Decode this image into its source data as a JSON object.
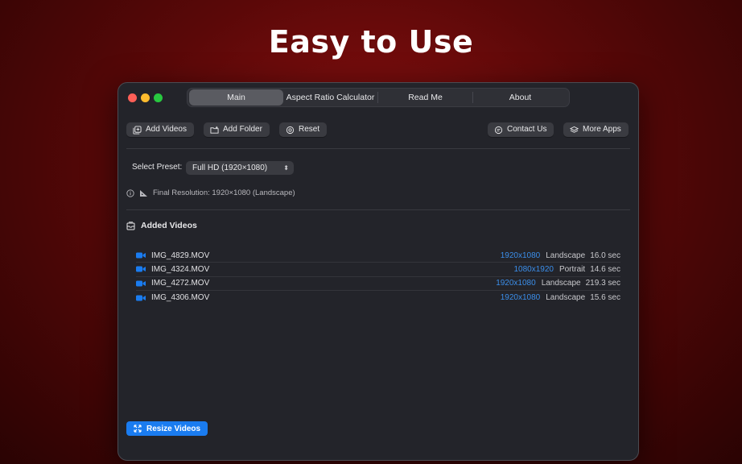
{
  "headline": "Easy to Use",
  "tabs": [
    {
      "label": "Main",
      "active": true
    },
    {
      "label": "Aspect Ratio Calculator",
      "active": false
    },
    {
      "label": "Read Me",
      "active": false
    },
    {
      "label": "About",
      "active": false
    }
  ],
  "toolbar": {
    "add_videos": "Add Videos",
    "add_folder": "Add Folder",
    "reset": "Reset",
    "contact_us": "Contact Us",
    "more_apps": "More Apps"
  },
  "preset": {
    "label": "Select Preset:",
    "value": "Full HD (1920×1080)"
  },
  "resolution_text": "Final Resolution: 1920×1080 (Landscape)",
  "section_title": "Added Videos",
  "videos": [
    {
      "name": "IMG_4829.MOV",
      "resolution": "1920x1080",
      "orientation": "Landscape",
      "duration": "16.0 sec"
    },
    {
      "name": "IMG_4324.MOV",
      "resolution": "1080x1920",
      "orientation": "Portrait",
      "duration": "14.6 sec"
    },
    {
      "name": "IMG_4272.MOV",
      "resolution": "1920x1080",
      "orientation": "Landscape",
      "duration": "219.3 sec"
    },
    {
      "name": "IMG_4306.MOV",
      "resolution": "1920x1080",
      "orientation": "Landscape",
      "duration": "15.6 sec"
    }
  ],
  "resize_button": "Resize Videos",
  "colors": {
    "accent": "#1a7cf0",
    "resolution_link": "#3b8eea",
    "background": "#23242a"
  }
}
